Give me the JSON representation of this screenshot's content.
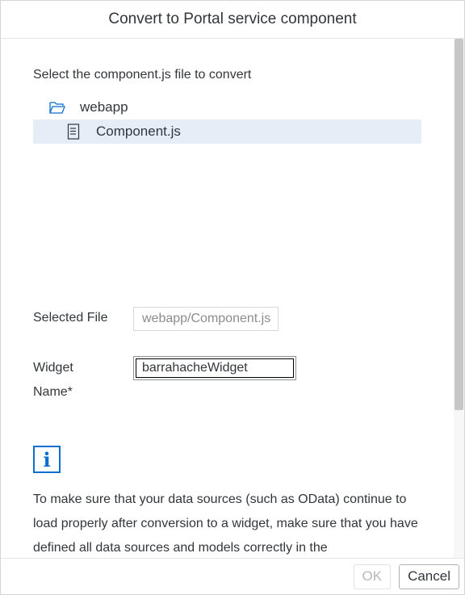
{
  "dialog": {
    "title": "Convert to Portal service component"
  },
  "content": {
    "instruction": "Select the component.js file to convert",
    "tree": [
      {
        "label": "webapp",
        "icon": "folder-open-icon",
        "selected": false
      },
      {
        "label": "Component.js",
        "icon": "document-icon",
        "selected": true
      }
    ],
    "selected_file": {
      "label": "Selected File",
      "value": "webapp/Component.js"
    },
    "widget_name": {
      "label_line1": "Widget",
      "label_line2": "Name*",
      "value": "barrahacheWidget"
    },
    "info": {
      "icon": "info-icon",
      "text": "To make sure that your data sources (such as OData) continue to load properly after conversion to a widget, make sure that you have defined all data sources and models correctly in the"
    }
  },
  "footer": {
    "ok_label": "OK",
    "cancel_label": "Cancel"
  },
  "colors": {
    "accent": "#0a6ed1",
    "selection": "#e5eef7"
  }
}
